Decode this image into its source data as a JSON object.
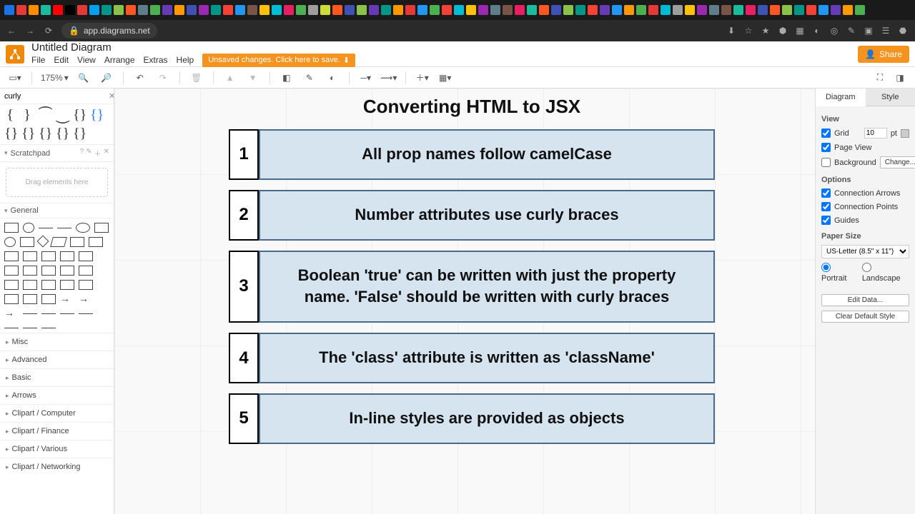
{
  "browser": {
    "url_host": "app.diagrams.net",
    "tab_colors": [
      "#1a73e8",
      "#e53935",
      "#fb8c00",
      "#1abc9c",
      "#ff0000",
      "#000",
      "#e53935",
      "#00a1f1",
      "#009688",
      "#8bc34a",
      "#ff5722",
      "#607d8b",
      "#4caf50",
      "#673ab7",
      "#ff9800",
      "#3f51b5",
      "#9c27b0",
      "#009688",
      "#f44336",
      "#2196f3",
      "#795548",
      "#ffc107",
      "#00bcd4",
      "#e91e63",
      "#4caf50",
      "#9e9e9e",
      "#cddc39",
      "#ff5722",
      "#3f51b5",
      "#8bc34a",
      "#673ab7",
      "#009688",
      "#ff9800",
      "#e53935",
      "#2196f3",
      "#4caf50",
      "#f44336",
      "#00bcd4",
      "#ffc107",
      "#9c27b0",
      "#607d8b",
      "#795548",
      "#e91e63",
      "#1abc9c",
      "#ff5722",
      "#3f51b5",
      "#8bc34a",
      "#009688",
      "#f44336",
      "#673ab7",
      "#2196f3",
      "#ff9800",
      "#4caf50",
      "#e53935",
      "#00bcd4",
      "#9e9e9e",
      "#ffc107",
      "#9c27b0",
      "#607d8b",
      "#795548",
      "#1abc9c",
      "#e91e63",
      "#3f51b5",
      "#ff5722",
      "#8bc34a",
      "#009688",
      "#f44336",
      "#2196f3",
      "#673ab7",
      "#ff9800",
      "#4caf50"
    ]
  },
  "app": {
    "title": "Untitled Diagram",
    "menus": [
      "File",
      "Edit",
      "View",
      "Arrange",
      "Extras",
      "Help"
    ],
    "unsaved_msg": "Unsaved changes. Click here to save.",
    "share_label": "Share"
  },
  "toolbar": {
    "zoom": "175%"
  },
  "left": {
    "search_value": "curly",
    "scratchpad_label": "Scratchpad",
    "scratch_drop": "Drag elements here",
    "general_label": "General",
    "categories": [
      "Misc",
      "Advanced",
      "Basic",
      "Arrows",
      "Clipart / Computer",
      "Clipart / Finance",
      "Clipart / Various",
      "Clipart / Networking"
    ]
  },
  "diagram": {
    "title": "Converting HTML to JSX",
    "rules": [
      {
        "n": "1",
        "text": "All prop names follow camelCase"
      },
      {
        "n": "2",
        "text": "Number attributes use curly braces"
      },
      {
        "n": "3",
        "text": "Boolean 'true' can be written with just the property name. 'False' should be written with curly braces"
      },
      {
        "n": "4",
        "text": "The 'class' attribute is written as 'className'"
      },
      {
        "n": "5",
        "text": "In-line styles are provided as objects"
      }
    ]
  },
  "right": {
    "tabs": [
      "Diagram",
      "Style"
    ],
    "view_label": "View",
    "grid_label": "Grid",
    "grid_size": "10",
    "grid_unit": "pt",
    "pageview_label": "Page View",
    "background_label": "Background",
    "change_label": "Change...",
    "options_label": "Options",
    "conn_arrows": "Connection Arrows",
    "conn_points": "Connection Points",
    "guides": "Guides",
    "paper_label": "Paper Size",
    "paper_value": "US-Letter (8.5\" x 11\")",
    "portrait": "Portrait",
    "landscape": "Landscape",
    "edit_data": "Edit Data...",
    "clear_style": "Clear Default Style"
  }
}
